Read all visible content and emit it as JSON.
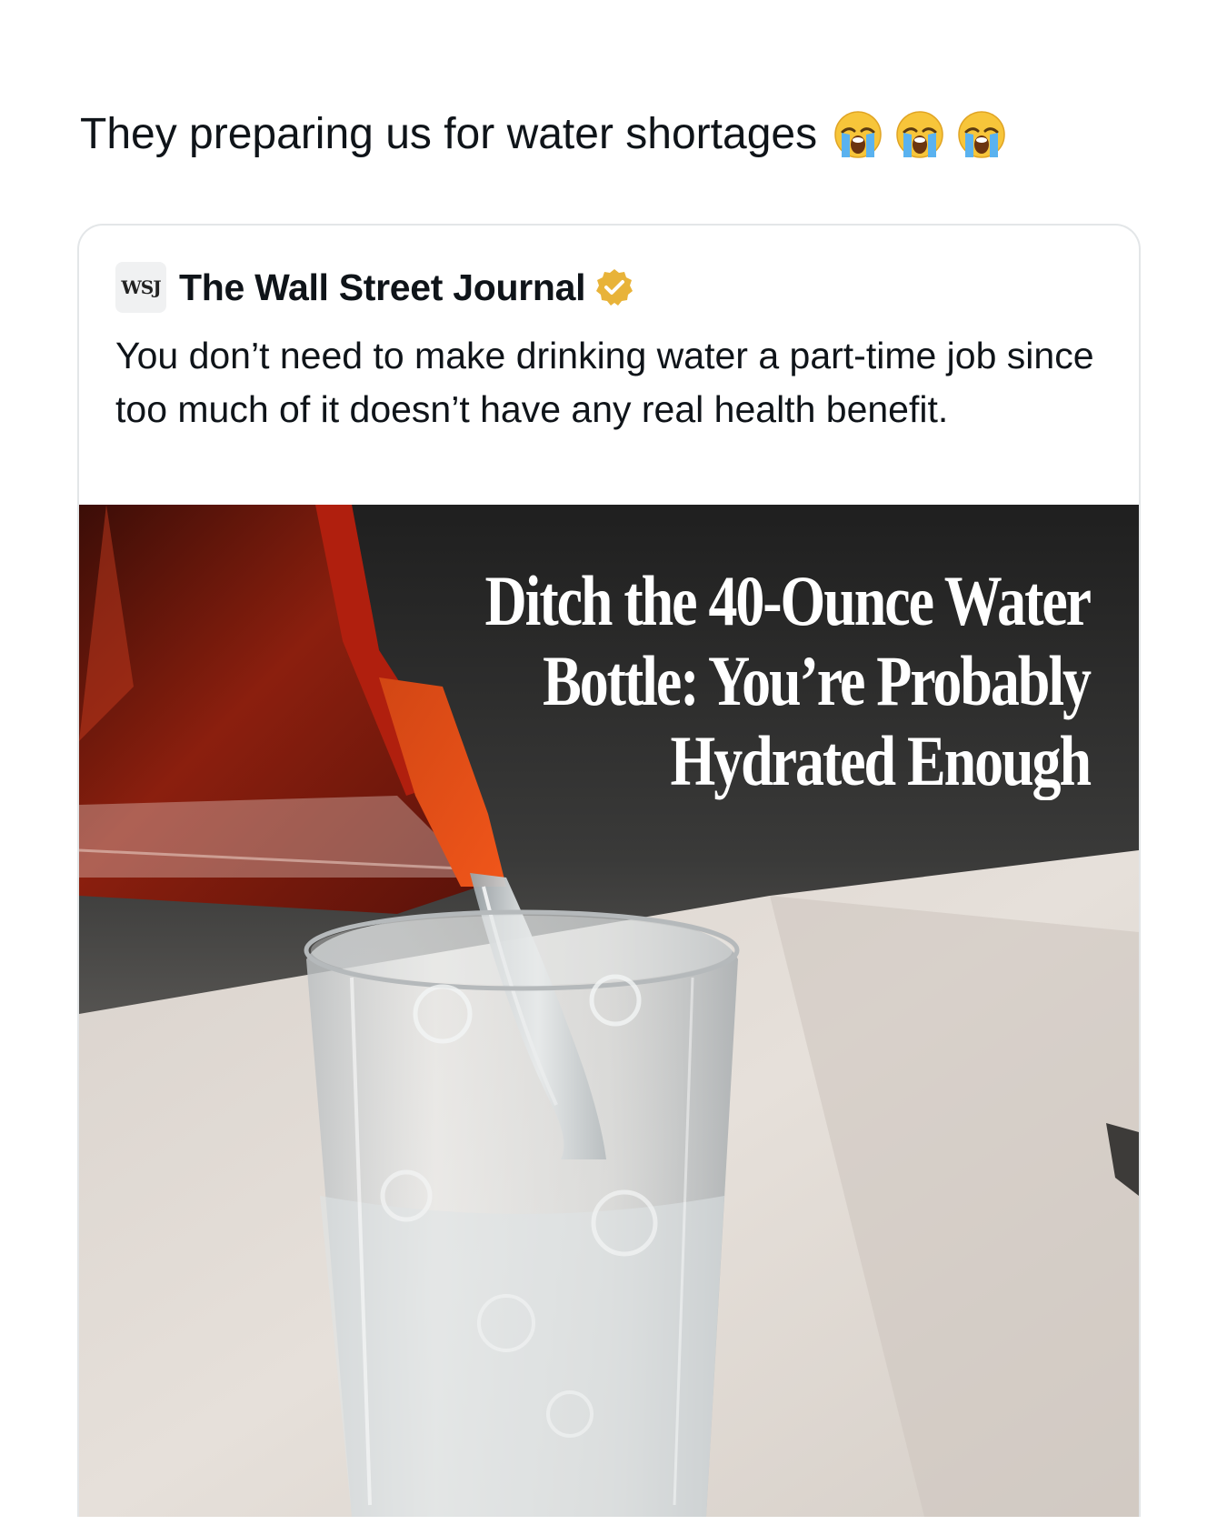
{
  "post": {
    "text": "They preparing us for water shortages",
    "emojis": [
      "loudly-crying-face",
      "loudly-crying-face",
      "loudly-crying-face"
    ]
  },
  "quoted_tweet": {
    "avatar_text": "WSJ",
    "author_name": "The Wall Street Journal",
    "verified": true,
    "verified_badge_color": "#e8b339",
    "body": "You don’t need to make drinking water a part-time job since too much of it doesn’t have any real health benefit.",
    "image": {
      "headline": "Ditch the 40-Ounce Water Bottle: You’re Probably Hydrated Enough",
      "description": "photo-pitcher-pouring-water-into-glass"
    }
  }
}
